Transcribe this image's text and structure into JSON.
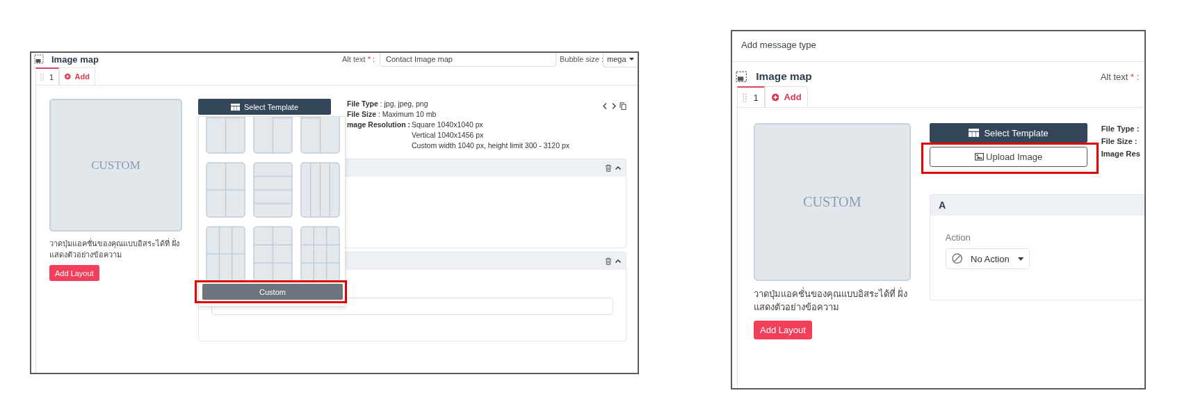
{
  "left_screenshot": {
    "cropped": false,
    "editor": {
      "title": "Image map",
      "alt_text": {
        "label": "Alt text",
        "required_mark": "*",
        "suffix": ":",
        "value": "Contact Image map"
      },
      "bubble_size": {
        "label": "Bubble size :",
        "value": "mega"
      },
      "tabs": [
        {
          "label": "1",
          "kind": "page",
          "selected": true
        },
        {
          "label": "Add",
          "kind": "add",
          "selected": false
        }
      ],
      "preview_label": "CUSTOM",
      "hint": "วาดปุ่มแอคชั่นของคุณแบบอิสระได้ที่ ฝั่งแสดงตัวอย่างข้อความ",
      "add_layout_button": "Add Layout",
      "select_template_button": "Select Template",
      "template_menu": {
        "custom_button": {
          "label": "Custom",
          "highlighted": true
        }
      },
      "file_info": [
        {
          "text": "**File Type** : jpg, jpeg, png"
        },
        {
          "text": "**File Size** : Maximum 10 mb"
        },
        {
          "text": "**mage Resolution :**",
          "values": [
            "Square 1040x1040 px",
            "Vertical 1040x1456 px",
            "Custom width 1040 px, height limit 300 - 3120 px"
          ]
        }
      ],
      "panels": [
        {
          "kind": "covered"
        },
        {
          "kind": "covered_dropdown"
        }
      ]
    }
  },
  "right_screenshot": {
    "cropped": true,
    "header": "Add message type",
    "editor": {
      "title": "Image map",
      "alt_text": {
        "label": "Alt text",
        "required_mark": "*",
        "suffix": ":"
      },
      "tabs": [
        {
          "label": "1",
          "kind": "page",
          "selected": true
        },
        {
          "label": "Add",
          "kind": "add",
          "selected": false
        }
      ],
      "preview_label": "CUSTOM",
      "hint": "วาดปุ่มแอคชั่นของคุณแบบอิสระได้ที่ ฝั่งแสดงตัวอย่างข้อความ",
      "add_layout_button": "Add Layout",
      "select_template_button": "Select Template",
      "upload_button": {
        "label": "Upload Image",
        "highlighted": true
      },
      "file_info": [
        {
          "text": "**File Type :**"
        },
        {
          "text": "**File Size :**"
        },
        {
          "text": "**Image Res**"
        }
      ],
      "panels": [
        {
          "kind": "action",
          "title": "A",
          "action_label": "Action",
          "action_value": "No Action"
        }
      ]
    }
  }
}
